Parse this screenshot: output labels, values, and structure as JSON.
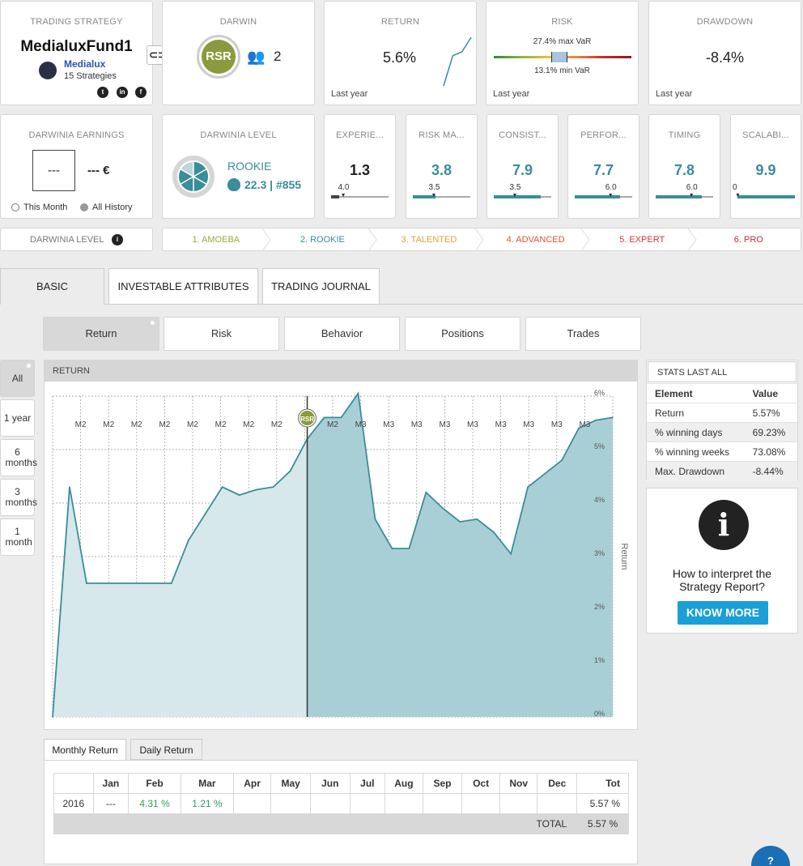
{
  "strategy": {
    "title": "TRADING STRATEGY",
    "name": "MedialuxFund1",
    "author": "Medialux",
    "strategies": "15 Strategies",
    "link_icon": "link-icon",
    "social": [
      "twitter-icon",
      "linkedin-icon",
      "facebook-icon"
    ]
  },
  "darwin": {
    "title": "DARWIN",
    "badge": "RSR",
    "investors": "2",
    "badge_color": "#8a9a3c"
  },
  "return_card": {
    "title": "RETURN",
    "value": "5.6%",
    "footer": "Last year",
    "sparkline": [
      0.0,
      0.62,
      0.7,
      1.0
    ]
  },
  "risk_card": {
    "title": "RISK",
    "max_var": "27.4% max VaR",
    "min_var": "13.1% min VaR",
    "footer": "Last year"
  },
  "drawdown_card": {
    "title": "DRAWDOWN",
    "value": "-8.4%",
    "footer": "Last year"
  },
  "earnings": {
    "title": "DARWINIA EARNINGS",
    "box": "---",
    "value": "--- €",
    "opt_month": "This Month",
    "opt_all": "All History"
  },
  "level": {
    "title": "DARWINIA LEVEL",
    "name": "ROOKIE",
    "score": "22.3 | #855"
  },
  "scores": [
    {
      "title": "EXPERIE...",
      "value": "1.3",
      "mark": "4.0",
      "fill": 0.0,
      "mark_pos": 0.2,
      "color": "#222222"
    },
    {
      "title": "RISK MA...",
      "value": "3.8",
      "mark": "3.5",
      "fill": 0.38,
      "mark_pos": 0.35,
      "color": "#3a8d99"
    },
    {
      "title": "CONSIST...",
      "value": "7.9",
      "mark": "3.5",
      "fill": 0.79,
      "mark_pos": 0.35,
      "color": "#3a8d99"
    },
    {
      "title": "PERFOR...",
      "value": "7.7",
      "mark": "6.0",
      "fill": 0.77,
      "mark_pos": 0.6,
      "color": "#3a8d99"
    },
    {
      "title": "TIMING",
      "value": "7.8",
      "mark": "6.0",
      "fill": 0.78,
      "mark_pos": 0.6,
      "color": "#3a8d99"
    },
    {
      "title": "SCALABI...",
      "value": "9.9",
      "mark": "0",
      "fill": 0.99,
      "mark_pos": 0.0,
      "color": "#3a8d99"
    }
  ],
  "level_bar": {
    "label": "DARWINIA LEVEL",
    "steps": [
      {
        "label": "1. AMOEBA",
        "color": "#9aaa3a"
      },
      {
        "label": "2. ROOKIE",
        "color": "#3a8d99"
      },
      {
        "label": "3. TALENTED",
        "color": "#e7a03a"
      },
      {
        "label": "4. ADVANCED",
        "color": "#e0523a"
      },
      {
        "label": "5. EXPERT",
        "color": "#d9343a"
      },
      {
        "label": "6. PRO",
        "color": "#b8303a"
      }
    ]
  },
  "tabs": [
    "BASIC",
    "INVESTABLE ATTRIBUTES",
    "TRADING JOURNAL"
  ],
  "subtabs": [
    "Return",
    "Risk",
    "Behavior",
    "Positions",
    "Trades"
  ],
  "periods": [
    "All",
    "1 year",
    "6 months",
    "3 months",
    "1 month"
  ],
  "chart_panel": {
    "header": "RETURN",
    "marker": "RSR"
  },
  "chart_data": {
    "type": "area",
    "ylabel": "Return",
    "ylim": [
      0,
      6
    ],
    "yticks": [
      "0%",
      "1%",
      "2%",
      "3%",
      "4%",
      "5%",
      "6%"
    ],
    "xticks": [
      "M2",
      "M2",
      "M2",
      "M2",
      "M2",
      "M2",
      "M2",
      "M2",
      "M2",
      "M2",
      "M3",
      "M3",
      "M3",
      "M3",
      "M3",
      "M3",
      "M3",
      "M3",
      "M3"
    ],
    "split_index": 15,
    "values": [
      0.0,
      4.3,
      2.5,
      2.5,
      2.5,
      2.5,
      2.5,
      2.5,
      3.3,
      3.8,
      4.3,
      4.15,
      4.25,
      4.3,
      4.6,
      5.2,
      5.6,
      5.6,
      6.05,
      3.7,
      3.15,
      3.15,
      4.2,
      3.9,
      3.65,
      3.7,
      3.45,
      3.05,
      4.3,
      4.55,
      4.8,
      5.4,
      5.55,
      5.6
    ]
  },
  "stats": {
    "title": "STATS LAST ALL",
    "head": [
      "Element",
      "Value"
    ],
    "rows": [
      [
        "Return",
        "5.57%"
      ],
      [
        "% winning days",
        "69.23%"
      ],
      [
        "% winning weeks",
        "73.08%"
      ],
      [
        "Max. Drawdown",
        "-8.44%"
      ]
    ]
  },
  "help": {
    "text": "How to interpret the Strategy Report?",
    "button": "KNOW MORE"
  },
  "monthly": {
    "tabs": [
      "Monthly Return",
      "Daily Return"
    ],
    "headers": [
      "",
      "Jan",
      "Feb",
      "Mar",
      "Apr",
      "May",
      "Jun",
      "Jul",
      "Aug",
      "Sep",
      "Oct",
      "Nov",
      "Dec",
      "Tot"
    ],
    "row": [
      "2016",
      "---",
      "4.31 %",
      "1.21 %",
      "",
      "",
      "",
      "",
      "",
      "",
      "",
      "",
      "",
      "5.57 %"
    ],
    "total_label": "TOTAL",
    "total_value": "5.57 %"
  },
  "chat": "?"
}
